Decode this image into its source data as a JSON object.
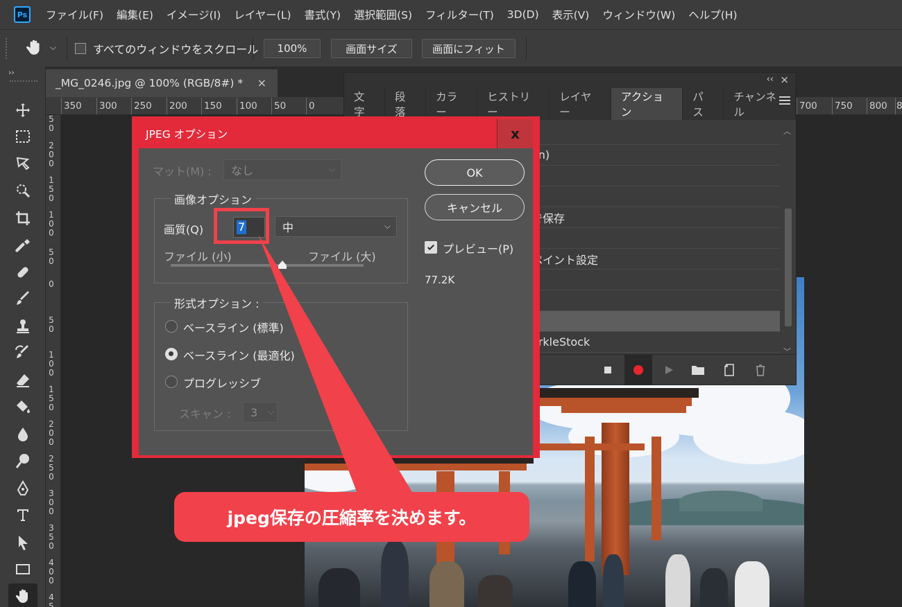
{
  "app": {
    "logo_text": "Ps"
  },
  "menubar": {
    "items": [
      "ファイル(F)",
      "編集(E)",
      "イメージ(I)",
      "レイヤー(L)",
      "書式(Y)",
      "選択範囲(S)",
      "フィルター(T)",
      "3D(D)",
      "表示(V)",
      "ウィンドウ(W)",
      "ヘルプ(H)"
    ]
  },
  "optionsbar": {
    "scroll_all_label": "すべてのウィンドウをスクロール",
    "zoom_button": "100%",
    "screen_size_button": "画面サイズ",
    "fit_screen_button": "画面にフィット"
  },
  "document": {
    "tab_title": "_MG_0246.jpg @ 100% (RGB/8#) *",
    "tab_close": "×"
  },
  "rulers": {
    "h_labels_left": [
      "350",
      "300",
      "250",
      "200",
      "150",
      "100",
      "50",
      "0"
    ],
    "h_labels_right": [
      "700",
      "750",
      "800",
      "8"
    ],
    "v_labels": [
      "5\n0",
      "2\n0\n0",
      "1\n5\n0",
      "1\n0\n0",
      "5\n0",
      "0",
      "5\n0",
      "1\n0\n0",
      "1\n5\n0",
      "2\n0\n0",
      "2\n5\n0",
      "3\n0\n0",
      "3\n5\n0",
      "4\n0\n0",
      "4\n5\n0"
    ]
  },
  "panel": {
    "collapse": "‹‹",
    "close": "×",
    "tabs": [
      "文字",
      "段落",
      "カラー",
      "ヒストリー",
      "レイヤー",
      "アクション",
      "パス",
      "チャンネル"
    ],
    "active_tab": "アクション",
    "rows": [
      "",
      "on)",
      "",
      "で保存",
      "",
      "ペイント設定",
      "",
      "",
      "",
      "arkleStock"
    ]
  },
  "dialog": {
    "title": "JPEG オプション",
    "close": "x",
    "matte_label": "マット(M) :",
    "matte_value": "なし",
    "image_options_title": "画像オプション",
    "quality_label": "画質(Q)",
    "quality_value": "7",
    "quality_preset": "中",
    "file_small": "ファイル (小)",
    "file_large": "ファイル (大)",
    "quality_slider_fraction": 0.58,
    "format_options_title": "形式オプション :",
    "format_options": [
      "ベースライン (標準)",
      "ベースライン (最適化)",
      "プログレッシブ"
    ],
    "format_selected_index": 1,
    "scan_label": "スキャン :",
    "scan_value": "3",
    "ok_button": "OK",
    "cancel_button": "キャンセル",
    "preview_label": "プレビュー(P)",
    "preview_checked": true,
    "file_size": "77.2K"
  },
  "annotation": {
    "callout_text": "jpeg保存の圧縮率を決めます。",
    "color": "#f1414a"
  }
}
